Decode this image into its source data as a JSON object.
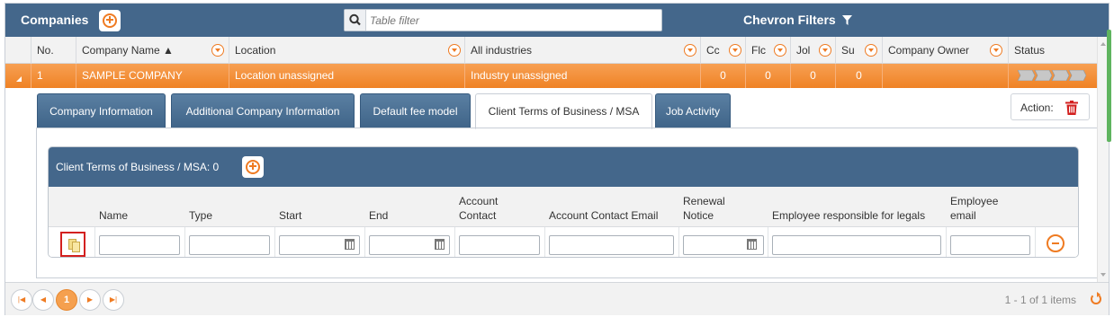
{
  "header": {
    "title": "Companies",
    "filter_placeholder": "Table filter",
    "filter_value": "",
    "chevron_filters": "Chevron Filters"
  },
  "columns": [
    {
      "label": "No."
    },
    {
      "label": "Company Name ▲"
    },
    {
      "label": "Location"
    },
    {
      "label": "All industries"
    },
    {
      "label": "Cc"
    },
    {
      "label": "Flc"
    },
    {
      "label": "Jol"
    },
    {
      "label": "Su"
    },
    {
      "label": "Company Owner"
    },
    {
      "label": "Status"
    }
  ],
  "row": {
    "no": "1",
    "company": "SAMPLE COMPANY",
    "location": "Location unassigned",
    "industry": "Industry unassigned",
    "cc": "0",
    "flc": "0",
    "jol": "0",
    "su": "0",
    "owner": ""
  },
  "tabs": [
    {
      "label": "Company Information",
      "active": false
    },
    {
      "label": "Additional Company Information",
      "active": false
    },
    {
      "label": "Default fee model",
      "active": false
    },
    {
      "label": "Client Terms of Business / MSA",
      "active": true
    },
    {
      "label": "Job Activity",
      "active": false
    }
  ],
  "action": {
    "label": "Action:",
    "icon": "trash-icon"
  },
  "subgrid": {
    "title": "Client Terms of Business / MSA: 0",
    "columns": [
      "Name",
      "Type",
      "Start",
      "End",
      "Account\nContact",
      "Account Contact Email",
      "Renewal\nNotice",
      "Employee responsible for legals",
      "Employee\nemail"
    ]
  },
  "pager": {
    "current_page": "1",
    "info": "1 - 1 of 1 items"
  },
  "colors": {
    "header": "#44678b",
    "accent": "#ef7b22",
    "selected_row": "#f0892c",
    "delete": "#d3201f"
  }
}
